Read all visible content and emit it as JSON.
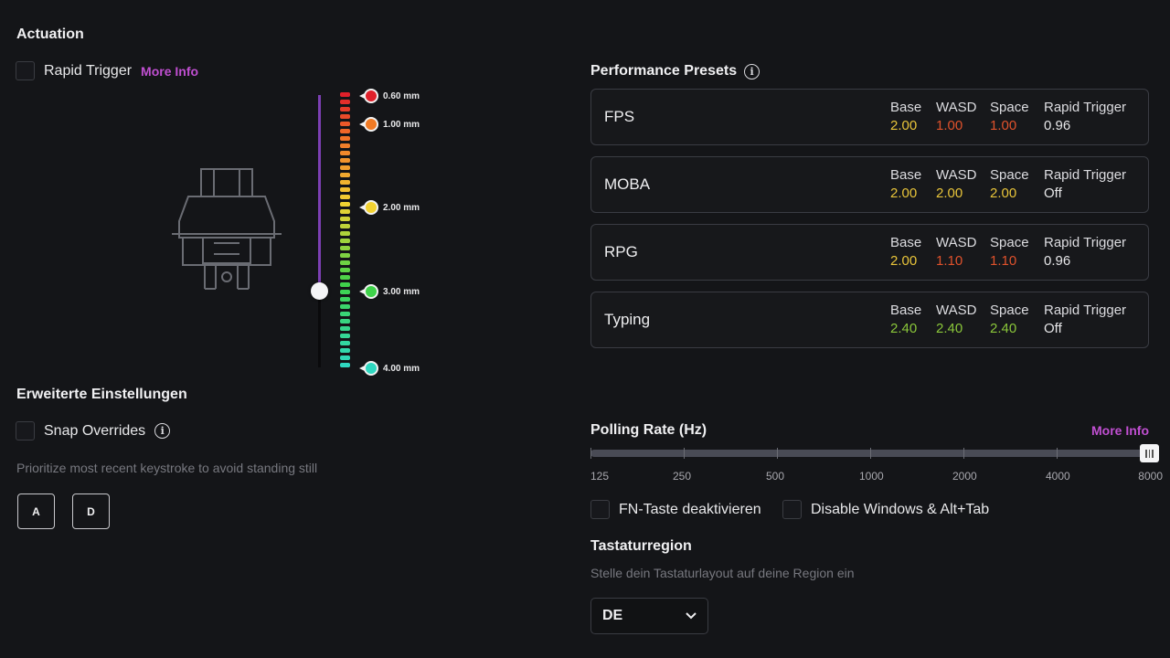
{
  "actuation": {
    "title": "Actuation",
    "rapid_trigger_label": "Rapid Trigger",
    "more_info": "More Info",
    "markers": [
      {
        "label": "0.60 mm",
        "color": "#e0202a"
      },
      {
        "label": "1.00 mm",
        "color": "#f07a24"
      },
      {
        "label": "2.00 mm",
        "color": "#f2d232"
      },
      {
        "label": "3.00 mm",
        "color": "#3fd24a"
      },
      {
        "label": "4.00 mm",
        "color": "#2fd8c0"
      }
    ],
    "slider_value": 0.72
  },
  "advanced": {
    "title": "Erweiterte Einstellungen",
    "snap_label": "Snap Overrides",
    "snap_desc": "Prioritize most recent keystroke to avoid standing still",
    "keys": [
      "A",
      "D"
    ]
  },
  "presets": {
    "title": "Performance Presets",
    "columns": [
      "Base",
      "WASD",
      "Space",
      "Rapid Trigger"
    ],
    "items": [
      {
        "name": "FPS",
        "values": [
          "2.00",
          "1.00",
          "1.00",
          "0.96"
        ],
        "colors": [
          "#e8c43a",
          "#e0522c",
          "#e0522c",
          "#e6e6e8"
        ]
      },
      {
        "name": "MOBA",
        "values": [
          "2.00",
          "2.00",
          "2.00",
          "Off"
        ],
        "colors": [
          "#e8c43a",
          "#e8c43a",
          "#e8c43a",
          "#e6e6e8"
        ]
      },
      {
        "name": "RPG",
        "values": [
          "2.00",
          "1.10",
          "1.10",
          "0.96"
        ],
        "colors": [
          "#e8c43a",
          "#e0522c",
          "#e0522c",
          "#e6e6e8"
        ]
      },
      {
        "name": "Typing",
        "values": [
          "2.40",
          "2.40",
          "2.40",
          "Off"
        ],
        "colors": [
          "#8ac63a",
          "#8ac63a",
          "#8ac63a",
          "#e6e6e8"
        ]
      }
    ]
  },
  "polling": {
    "title": "Polling Rate (Hz)",
    "more_info": "More Info",
    "ticks": [
      "125",
      "250",
      "500",
      "1000",
      "2000",
      "4000",
      "8000"
    ],
    "selected": "8000"
  },
  "toggles": {
    "fn_label": "FN-Taste deaktivieren",
    "win_label": "Disable Windows & Alt+Tab"
  },
  "region": {
    "title": "Tastaturregion",
    "desc": "Stelle dein Tastaturlayout auf deine Region ein",
    "selected": "DE"
  }
}
